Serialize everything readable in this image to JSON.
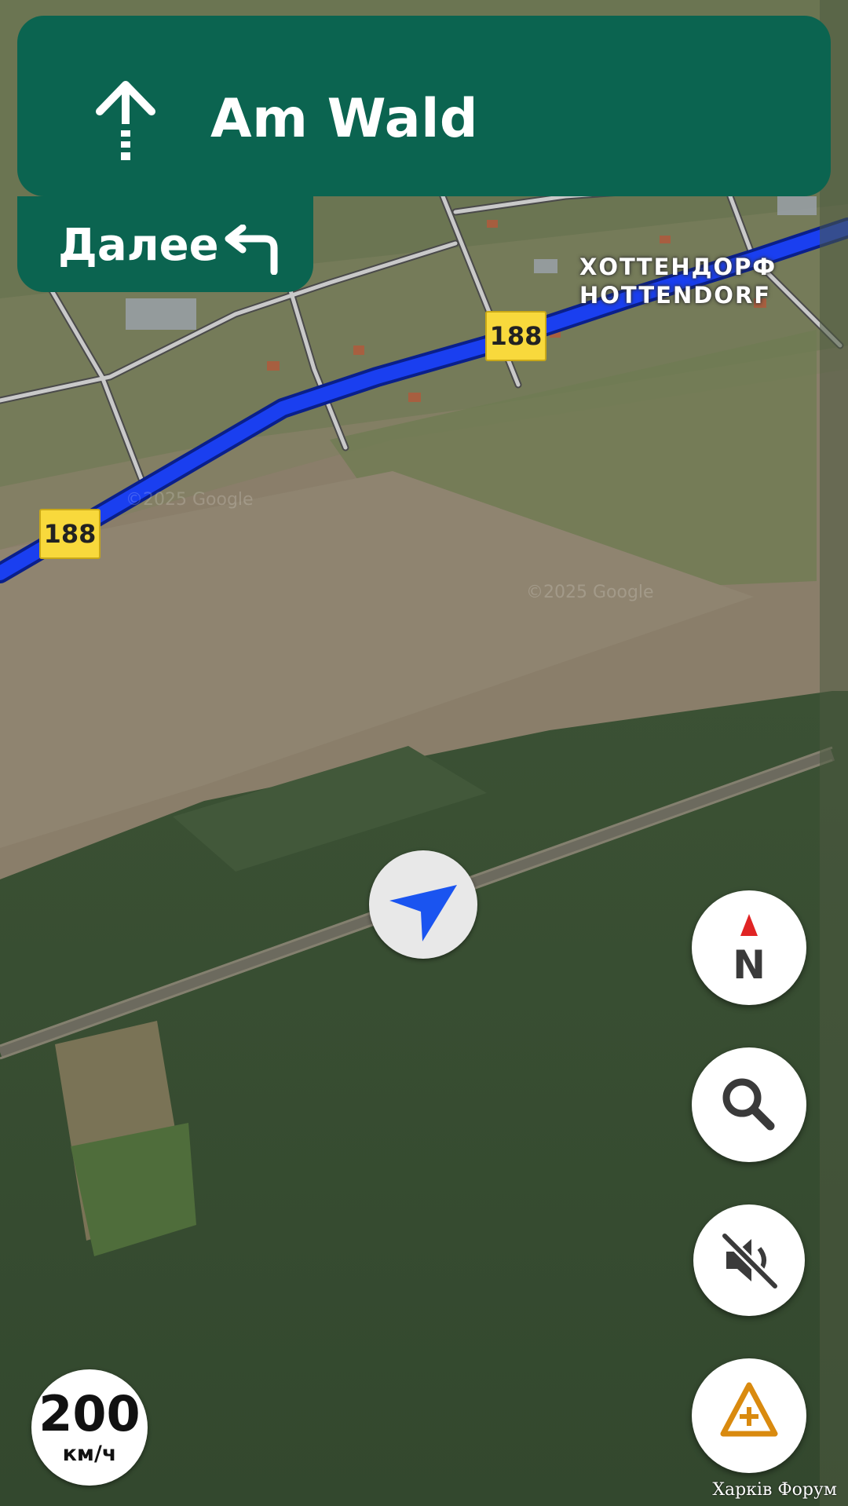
{
  "navigation": {
    "maneuver_icon": "straight-arrow-icon",
    "street_name": "Am Wald",
    "next_label": "Далее",
    "next_icon": "turn-left-arrow-icon",
    "banner_color": "#0b6450"
  },
  "map": {
    "route_color": "#1a3ff0",
    "road_shields": [
      "188",
      "188"
    ],
    "place_label_line1": "ХОТТЕНДОРФ",
    "place_label_line2": "HOTTENDORF",
    "copyright_1": "©2025 Google",
    "copyright_2": "©2025 Google"
  },
  "controls": {
    "compass_letter": "N",
    "compass_icon": "compass-icon",
    "search_icon": "search-icon",
    "mute_icon": "sound-off-icon",
    "report_icon": "report-incident-icon",
    "location_icon": "navigation-arrow-icon"
  },
  "speed": {
    "value": "200",
    "unit": "км/ч"
  },
  "watermark": "Харків Форум"
}
